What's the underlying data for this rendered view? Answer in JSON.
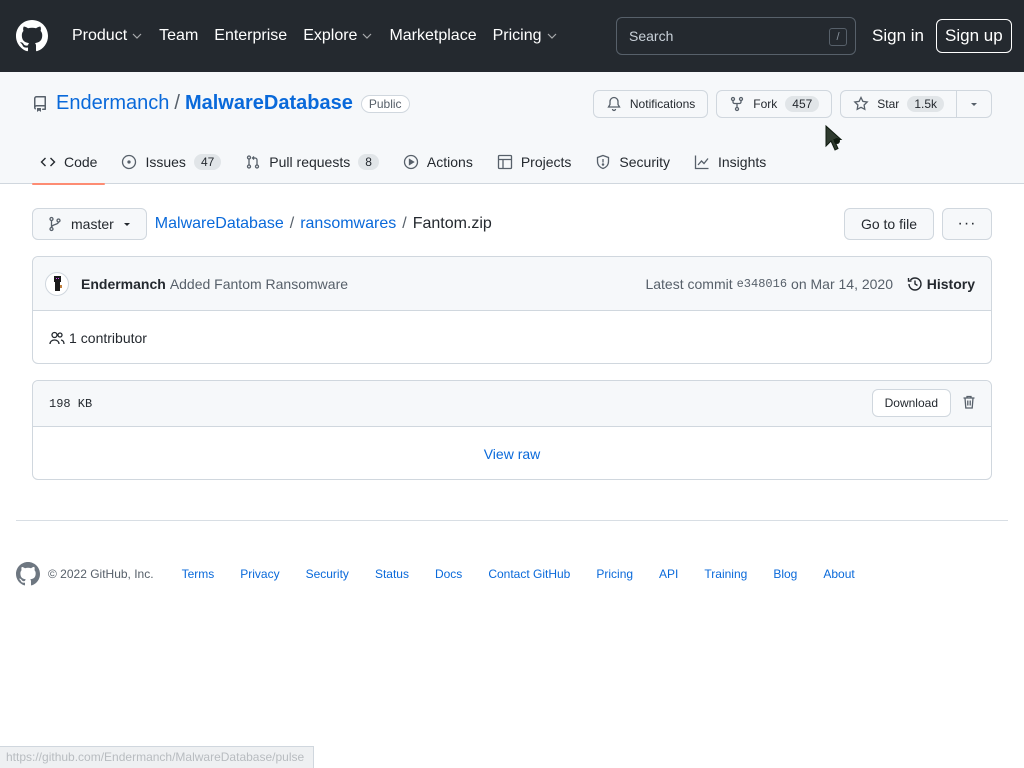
{
  "header": {
    "nav": [
      {
        "label": "Product",
        "dropdown": true
      },
      {
        "label": "Team",
        "dropdown": false
      },
      {
        "label": "Enterprise",
        "dropdown": false
      },
      {
        "label": "Explore",
        "dropdown": true
      },
      {
        "label": "Marketplace",
        "dropdown": false
      },
      {
        "label": "Pricing",
        "dropdown": true
      }
    ],
    "search_placeholder": "Search",
    "search_shortcut": "/",
    "signin_label": "Sign in",
    "signup_label": "Sign up"
  },
  "repo": {
    "owner": "Endermanch",
    "separator": "/",
    "name": "MalwareDatabase",
    "visibility": "Public",
    "notifications_label": "Notifications",
    "fork_label": "Fork",
    "fork_count": "457",
    "star_label": "Star",
    "star_count": "1.5k",
    "tabs": [
      {
        "label": "Code",
        "icon": "code-icon",
        "count": "",
        "active": true
      },
      {
        "label": "Issues",
        "icon": "issue-opened-icon",
        "count": "47",
        "active": false
      },
      {
        "label": "Pull requests",
        "icon": "git-pull-request-icon",
        "count": "8",
        "active": false
      },
      {
        "label": "Actions",
        "icon": "play-icon",
        "count": "",
        "active": false
      },
      {
        "label": "Projects",
        "icon": "table-icon",
        "count": "",
        "active": false
      },
      {
        "label": "Security",
        "icon": "shield-icon",
        "count": "",
        "active": false
      },
      {
        "label": "Insights",
        "icon": "graph-icon",
        "count": "",
        "active": false
      }
    ]
  },
  "breadcrumb": {
    "branch": "master",
    "path": [
      "MalwareDatabase",
      "ransomwares"
    ],
    "file": "Fantom.zip",
    "goto_file_label": "Go to file",
    "more_label": "···"
  },
  "commit": {
    "author": "Endermanch",
    "message": "Added Fantom Ransomware",
    "latest_label": "Latest commit",
    "sha": "e348016",
    "date_text": "on Mar 14, 2020",
    "history_label": "History",
    "contributors_count": "1",
    "contributors_label": "contributor"
  },
  "file": {
    "size": "198 KB",
    "download_label": "Download",
    "view_raw_label": "View raw"
  },
  "footer": {
    "copyright": "© 2022 GitHub, Inc.",
    "links": [
      "Terms",
      "Privacy",
      "Security",
      "Status",
      "Docs",
      "Contact GitHub",
      "Pricing",
      "API",
      "Training",
      "Blog",
      "About"
    ]
  },
  "status_bar": {
    "url": "https://github.com/Endermanch/MalwareDatabase/pulse"
  },
  "colors": {
    "header_bg": "#24292f",
    "link": "#0969da",
    "active_tab_underline": "#fd8c73"
  }
}
